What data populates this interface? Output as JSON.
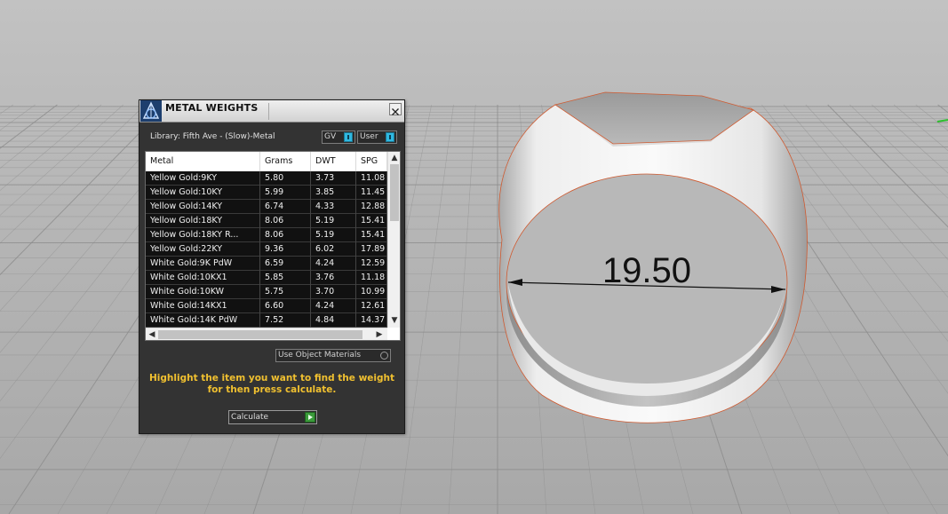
{
  "viewport": {
    "dimension_label": "19.50",
    "colors": {
      "background": "#c8c8c8",
      "grid": "#8f8f8f",
      "ring": "#d8d8d8",
      "edge": "#d4552a"
    }
  },
  "dialog": {
    "title": "METAL WEIGHTS",
    "icon": "app-logo-icon",
    "close_icon": "close-icon",
    "library_label": "Library: Fifth Ave - (Slow)-Metal",
    "toggles": [
      {
        "label": "GV"
      },
      {
        "label": "User"
      }
    ],
    "table": {
      "columns": [
        "Metal",
        "Grams",
        "DWT",
        "SPG"
      ],
      "rows": [
        [
          "Yellow Gold:9KY",
          "5.80",
          "3.73",
          "11.08"
        ],
        [
          "Yellow Gold:10KY",
          "5.99",
          "3.85",
          "11.45"
        ],
        [
          "Yellow Gold:14KY",
          "6.74",
          "4.33",
          "12.88"
        ],
        [
          "Yellow Gold:18KY",
          "8.06",
          "5.19",
          "15.41"
        ],
        [
          "Yellow Gold:18KY R...",
          "8.06",
          "5.19",
          "15.41"
        ],
        [
          "Yellow Gold:22KY",
          "9.36",
          "6.02",
          "17.89"
        ],
        [
          "White Gold:9K PdW",
          "6.59",
          "4.24",
          "12.59"
        ],
        [
          "White Gold:10KX1",
          "5.85",
          "3.76",
          "11.18"
        ],
        [
          "White Gold:10KW",
          "5.75",
          "3.70",
          "10.99"
        ],
        [
          "White Gold:14KX1",
          "6.60",
          "4.24",
          "12.61"
        ],
        [
          "White Gold:14K PdW",
          "7.52",
          "4.84",
          "14.37"
        ]
      ]
    },
    "use_object_materials": "Use Object Materials",
    "hint": "Highlight the item you want to find the weight for then press calculate.",
    "calculate_label": "Calculate",
    "accent_color": "#f0c030"
  }
}
